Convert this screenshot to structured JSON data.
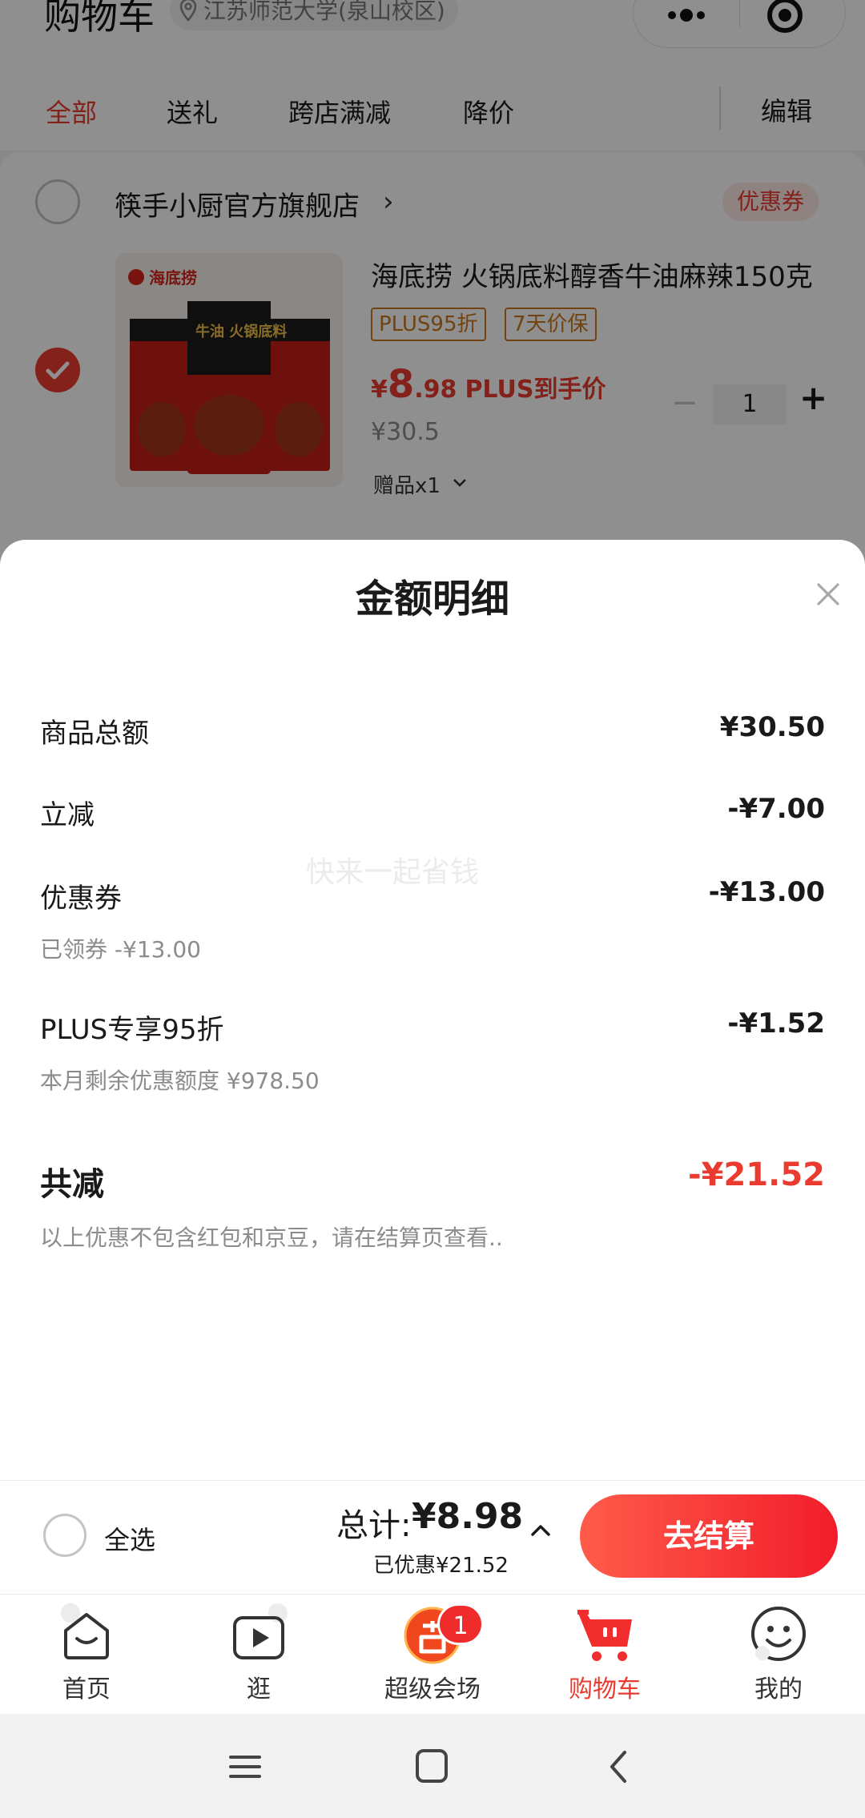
{
  "header": {
    "title": "购物车",
    "location": "江苏师范大学(泉山校区)",
    "capsule": {
      "more_icon": "more-dots-icon",
      "close_icon": "target-circle-icon"
    }
  },
  "tabs": [
    {
      "label": "全部",
      "active": true
    },
    {
      "label": "送礼",
      "active": false
    },
    {
      "label": "跨店满减",
      "active": false
    },
    {
      "label": "降价",
      "active": false
    }
  ],
  "edit_label": "编辑",
  "store": {
    "name": "筷手小厨官方旗舰店",
    "arrow": "›",
    "coupon_label": "优惠券",
    "selected": false
  },
  "product": {
    "selected": true,
    "title": "海底捞 火锅底料醇香牛油麻辣150克",
    "tags": [
      "PLUS95折",
      "7天价保"
    ],
    "price_symbol": "¥",
    "price_int": "8",
    "price_dec": ".98",
    "price_label": "PLUS到手价",
    "original_price": "¥30.5",
    "gift": "赠品x1",
    "quantity": "1",
    "image_brand": "海底捞",
    "image_text": "牛油 火锅底料"
  },
  "sheet": {
    "title": "金额明细",
    "watermark": "快来一起省钱",
    "rows": [
      {
        "label": "商品总额",
        "value": "¥30.50"
      },
      {
        "label": "立减",
        "value": "-¥7.00"
      },
      {
        "label": "优惠券",
        "value": "-¥13.00",
        "sub": "已领券 -¥13.00"
      },
      {
        "label": "PLUS专享95折",
        "value": "-¥1.52",
        "sub": "本月剩余优惠额度 ¥978.50"
      }
    ],
    "total_label": "共减",
    "total_value": "-¥21.52",
    "note": "以上优惠不包含红包和京豆，请在结算页查看.."
  },
  "checkout": {
    "select_all": "全选",
    "sum_label": "总计:",
    "sum_value": "¥8.98",
    "saved": "已优惠¥21.52",
    "pay_label": "去结算"
  },
  "tabbar": [
    {
      "label": "首页",
      "icon": "home-icon",
      "active": false
    },
    {
      "label": "逛",
      "icon": "video-play-icon",
      "active": false
    },
    {
      "label": "超级会场",
      "icon": "super-venue-icon",
      "active": false,
      "badge": "1"
    },
    {
      "label": "购物车",
      "icon": "cart-icon",
      "active": true
    },
    {
      "label": "我的",
      "icon": "smile-face-icon",
      "active": false
    }
  ],
  "colors": {
    "accent": "#e93b2f",
    "tag": "#c8781f",
    "muted": "#8c8c8c"
  }
}
